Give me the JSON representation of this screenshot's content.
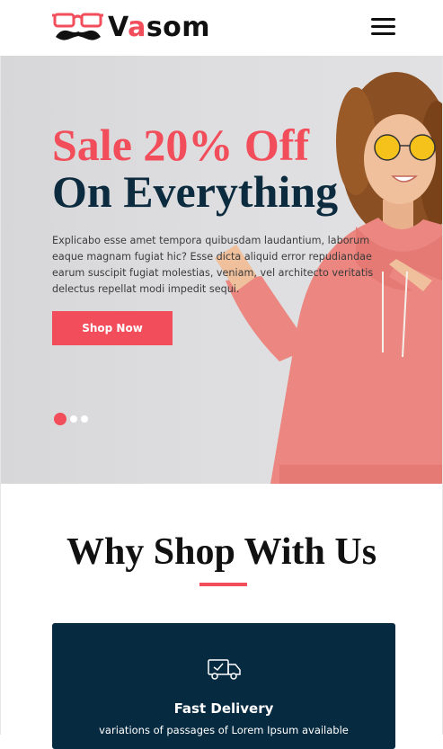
{
  "brand": {
    "name_prefix": "V",
    "name_accent": "a",
    "name_suffix": "som",
    "accent_color": "#f24d5a",
    "dark_color": "#0d2b3e"
  },
  "header": {
    "menu_icon": "hamburger-menu-icon"
  },
  "hero": {
    "title_line1": "Sale 20% Off",
    "title_line2": "On Everything",
    "description": "Explicabo esse amet tempora quibusdam laudantium, laborum eaque magnam fugiat hic? Esse dicta aliquid error repudiandae earum suscipit fugiat molestias, veniam, vel architecto veritatis delectus repellat modi impedit sequi.",
    "button_label": "Shop Now",
    "slides": 3,
    "active_slide": 1
  },
  "why_section": {
    "title": "Why Shop With Us"
  },
  "features": [
    {
      "icon": "delivery-truck-icon",
      "title": "Fast Delivery",
      "text": "variations of passages of Lorem Ipsum available"
    }
  ]
}
